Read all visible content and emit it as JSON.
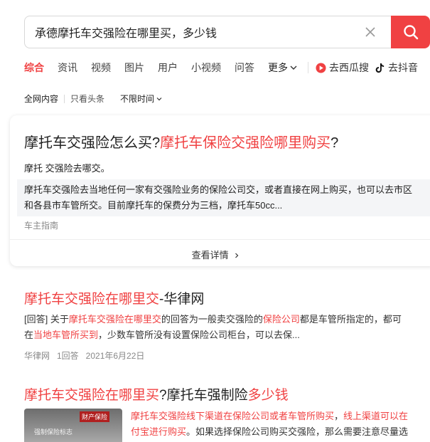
{
  "search": {
    "query": "承德摩托车交强险在哪里买，多少钱"
  },
  "tabs": [
    {
      "label": "综合"
    },
    {
      "label": "资讯"
    },
    {
      "label": "视频"
    },
    {
      "label": "图片"
    },
    {
      "label": "用户"
    },
    {
      "label": "小视频"
    },
    {
      "label": "问答"
    },
    {
      "label": "更多"
    }
  ],
  "external_links": [
    {
      "label": "去西瓜搜",
      "icon": "xigua-icon"
    },
    {
      "label": "去抖音",
      "icon": "douyin-icon"
    }
  ],
  "filters": {
    "all_web": "全网内容",
    "toutiao_only": "只看头条",
    "time": "不限时间"
  },
  "featured_card": {
    "title_plain": "摩托车交强险怎么买?",
    "title_red": "摩托车保险交强险哪里购买",
    "title_end": "?",
    "subtitle": "摩托 交强险去哪交。",
    "body_line1": "摩托车交强险去当地任何一家有交强险业务的保险公司交，或者直接在网上购买，也可以去市区",
    "body_line2": "和各县市车管所交。目前摩托车的保费分为三档，摩托车50cc...",
    "source": "车主指南",
    "more_label": "查看详情"
  },
  "results": [
    {
      "title_red": "摩托车交强险在哪里交",
      "title_plain": "-华律网",
      "snippet1_a": "[回答] 关于",
      "snippet1_b": "摩托车交强险在哪里交",
      "snippet1_c": "的回答为一般卖交强险的",
      "snippet1_d": "保险公司",
      "snippet1_e": "都是车管所指定的，都可",
      "snippet2_a": "在",
      "snippet2_b": "当地车管所买到",
      "snippet2_c": "，少数车管所没有设置保险公司柜台，可以去保...",
      "meta": "华律网   1回答   2021年6月22日"
    },
    {
      "title_red1": "摩托车交强险在哪里买",
      "title_plain": "?摩托车强制险",
      "title_red2": "多少钱",
      "snippet1_a": "摩托车交强险线下渠道在保险公司或者车管所购买",
      "snippet1_b": "，",
      "snippet1_c": "线上渠道可以在",
      "snippet2_a": "付宝进行购买",
      "snippet2_b": "。如果选择保险公司购买交强险，那么需要注意尽量选",
      "thumb_caption": "强制保险标志",
      "thumb_logo": "财产保险"
    }
  ],
  "colors": {
    "accent": "#f04142"
  }
}
